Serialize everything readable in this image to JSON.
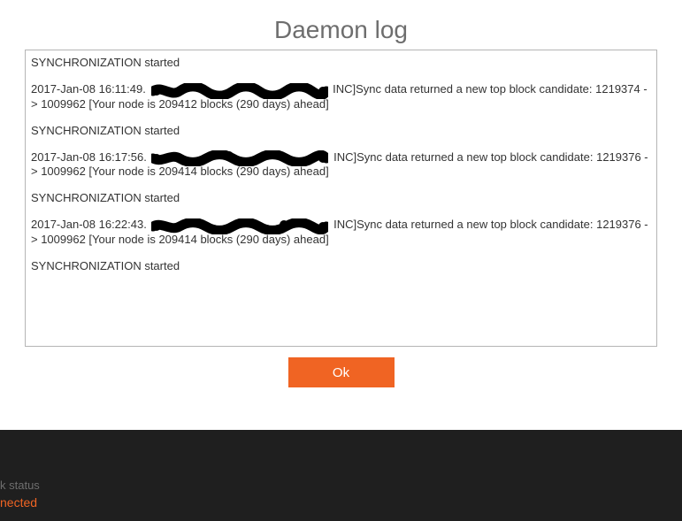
{
  "title": "Daemon log",
  "log": {
    "sync_started": "SYNCHRONIZATION started",
    "entries": [
      {
        "prefix": "2017-Jan-08 16:11:49.",
        "suffix": "INC]Sync data returned a new top block candidate: 1219374 -> 1009962 [Your node is 209412 blocks (290 days) ahead]"
      },
      {
        "prefix": "2017-Jan-08 16:17:56.",
        "suffix": "INC]Sync data returned a new top block candidate: 1219376 -> 1009962 [Your node is 209414 blocks (290 days) ahead]"
      },
      {
        "prefix": "2017-Jan-08 16:22:43.",
        "suffix": "INC]Sync data returned a new top block candidate: 1219376 -> 1009962 [Your node is 209414 blocks (290 days) ahead]"
      }
    ]
  },
  "ok_label": "Ok",
  "footer": {
    "status_label": "k status",
    "status_value": "nected"
  },
  "colors": {
    "accent": "#f06423",
    "title_gray": "#6e6e6e",
    "footer_bg": "#1f1f1f"
  }
}
